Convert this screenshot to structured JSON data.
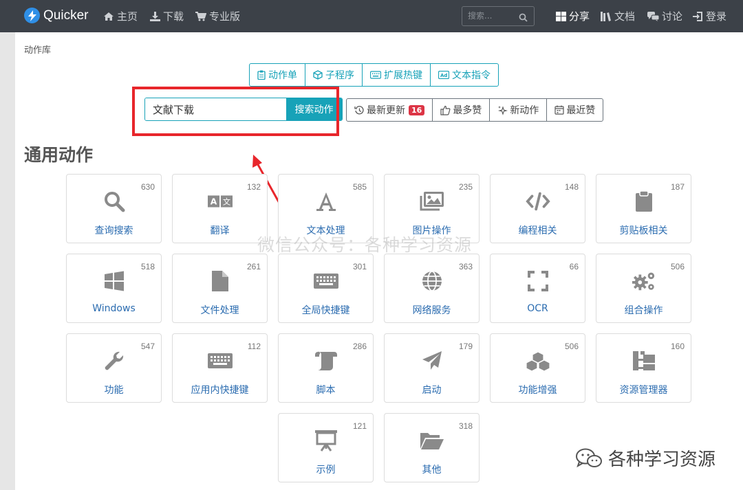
{
  "navbar": {
    "brand": "Quicker",
    "links": [
      "主页",
      "下载",
      "专业版"
    ],
    "search_placeholder": "搜索...",
    "right_links": [
      "分享",
      "文档",
      "讨论",
      "登录"
    ]
  },
  "breadcrumb": "动作库",
  "tabs": [
    "动作单",
    "子程序",
    "扩展热键",
    "文本指令"
  ],
  "search": {
    "value": "文献下载",
    "button": "搜索动作"
  },
  "sort": {
    "latest": "最新更新",
    "latest_badge": "16",
    "most_liked": "最多赞",
    "new": "新动作",
    "recent_liked": "最近赞"
  },
  "section_title": "通用动作",
  "categories": [
    {
      "label": "查询搜索",
      "count": "630",
      "icon": "search-icon"
    },
    {
      "label": "翻译",
      "count": "132",
      "icon": "translate-icon"
    },
    {
      "label": "文本处理",
      "count": "585",
      "icon": "font-icon"
    },
    {
      "label": "图片操作",
      "count": "235",
      "icon": "images-icon"
    },
    {
      "label": "编程相关",
      "count": "148",
      "icon": "code-icon"
    },
    {
      "label": "剪贴板相关",
      "count": "187",
      "icon": "clipboard-icon"
    },
    {
      "label": "Windows",
      "count": "518",
      "icon": "windows-icon"
    },
    {
      "label": "文件处理",
      "count": "261",
      "icon": "file-icon"
    },
    {
      "label": "全局快捷键",
      "count": "301",
      "icon": "keyboard-icon"
    },
    {
      "label": "网络服务",
      "count": "363",
      "icon": "globe-icon"
    },
    {
      "label": "OCR",
      "count": "66",
      "icon": "expand-icon"
    },
    {
      "label": "组合操作",
      "count": "506",
      "icon": "cogs-icon"
    },
    {
      "label": "功能",
      "count": "547",
      "icon": "wrench-icon"
    },
    {
      "label": "应用内快捷键",
      "count": "112",
      "icon": "keyboard-icon"
    },
    {
      "label": "脚本",
      "count": "286",
      "icon": "scroll-icon"
    },
    {
      "label": "启动",
      "count": "179",
      "icon": "paper-plane-icon"
    },
    {
      "label": "功能增强",
      "count": "506",
      "icon": "cubes-icon"
    },
    {
      "label": "资源管理器",
      "count": "160",
      "icon": "sitemap-icon"
    },
    {
      "label": "示例",
      "count": "121",
      "icon": "presentation-icon"
    },
    {
      "label": "其他",
      "count": "318",
      "icon": "folder-open-icon"
    }
  ],
  "watermark": "微信公众号：各种学习资源",
  "wechat_account": "各种学习资源",
  "colors": {
    "navbar": "#3c4148",
    "accent": "#17a2b8",
    "highlight": "#e8262b",
    "badge": "#dc3545",
    "link": "#2b6cb0"
  }
}
